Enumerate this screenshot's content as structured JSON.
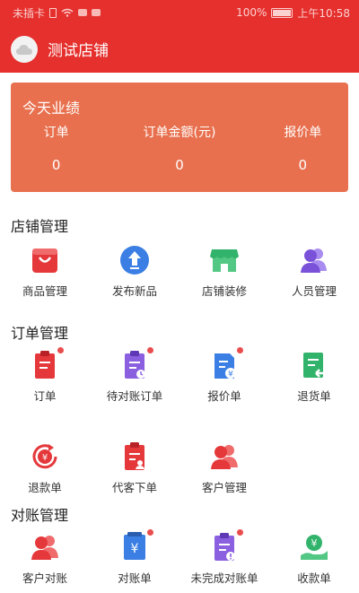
{
  "status_bar": {
    "carrier": "未插卡",
    "battery": "100%",
    "time": "上午10:58"
  },
  "header": {
    "title": "测试店铺"
  },
  "performance": {
    "title": "今天业绩",
    "metrics": [
      {
        "label": "订单",
        "value": "0"
      },
      {
        "label": "订单金额(元)",
        "value": "0"
      },
      {
        "label": "报价单",
        "value": "0"
      }
    ]
  },
  "sections": {
    "store": {
      "title": "店铺管理",
      "items": [
        {
          "label": "商品管理",
          "icon": "shopping-bag-icon",
          "badge": false
        },
        {
          "label": "发布新品",
          "icon": "upload-icon",
          "badge": false
        },
        {
          "label": "店铺装修",
          "icon": "storefront-icon",
          "badge": false
        },
        {
          "label": "人员管理",
          "icon": "people-icon",
          "badge": false
        }
      ]
    },
    "orders": {
      "title": "订单管理",
      "items": [
        {
          "label": "订单",
          "icon": "order-doc-icon",
          "badge": true
        },
        {
          "label": "待对账订单",
          "icon": "pending-reconcile-icon",
          "badge": true
        },
        {
          "label": "报价单",
          "icon": "quote-icon",
          "badge": true
        },
        {
          "label": "退货单",
          "icon": "return-goods-icon",
          "badge": false
        },
        {
          "label": "退款单",
          "icon": "refund-icon",
          "badge": false
        },
        {
          "label": "代客下单",
          "icon": "proxy-order-icon",
          "badge": false
        },
        {
          "label": "客户管理",
          "icon": "customers-icon",
          "badge": false
        }
      ]
    },
    "reconcile": {
      "title": "对账管理",
      "items": [
        {
          "label": "客户对账",
          "icon": "customer-reconcile-icon",
          "badge": false
        },
        {
          "label": "对账单",
          "icon": "statement-icon",
          "badge": true
        },
        {
          "label": "未完成对账单",
          "icon": "unfinished-statement-icon",
          "badge": true
        },
        {
          "label": "收款单",
          "icon": "receipt-icon",
          "badge": false
        }
      ]
    }
  },
  "colors": {
    "header": "#e5302d",
    "card": "#e8704e",
    "badge": "#e94d4d",
    "red_icon": "#e5383b",
    "blue_icon": "#3b7fe4",
    "green_icon": "#32b36b",
    "purple_icon": "#8a5fe0"
  }
}
